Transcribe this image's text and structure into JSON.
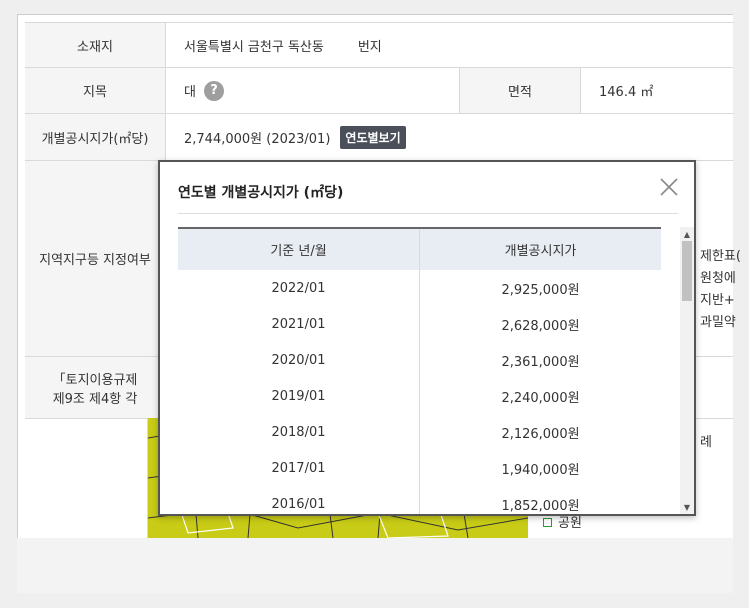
{
  "info": {
    "location_label": "소재지",
    "location_value_prefix": "서울특별시 금천구 독산동",
    "location_value_suffix": "번지",
    "land_category_label": "지목",
    "land_category_value": "대",
    "help_glyph": "?",
    "area_label": "면적",
    "area_value": "146.4 ㎡",
    "price_label": "개별공시지가(㎡당)",
    "price_value": "2,744,000원 (2023/01)",
    "year_button_label": "연도별보기",
    "zone_label": "지역지구등 지정여부",
    "partial_right": [
      "제한표(",
      "원청에",
      "지반+",
      "과밀약"
    ],
    "regulation_label_line1": "「토지이용규제",
    "regulation_label_line2": "제9조 제4항 각",
    "legend_partial": "례",
    "legend_item": "공원"
  },
  "popup": {
    "title": "연도별 개별공시지가 (㎡당)",
    "close_icon": "close-icon",
    "columns": [
      "기준 년/월",
      "개별공시지가"
    ],
    "rows": [
      [
        "2022/01",
        "2,925,000원"
      ],
      [
        "2021/01",
        "2,628,000원"
      ],
      [
        "2020/01",
        "2,361,000원"
      ],
      [
        "2019/01",
        "2,240,000원"
      ],
      [
        "2018/01",
        "2,126,000원"
      ],
      [
        "2017/01",
        "1,940,000원"
      ],
      [
        "2016/01",
        "1,852,000원"
      ]
    ]
  },
  "colors": {
    "map_fill": "#c8cc16",
    "header_bg": "#e8ecf3",
    "button_bg": "#4a4f5a"
  }
}
